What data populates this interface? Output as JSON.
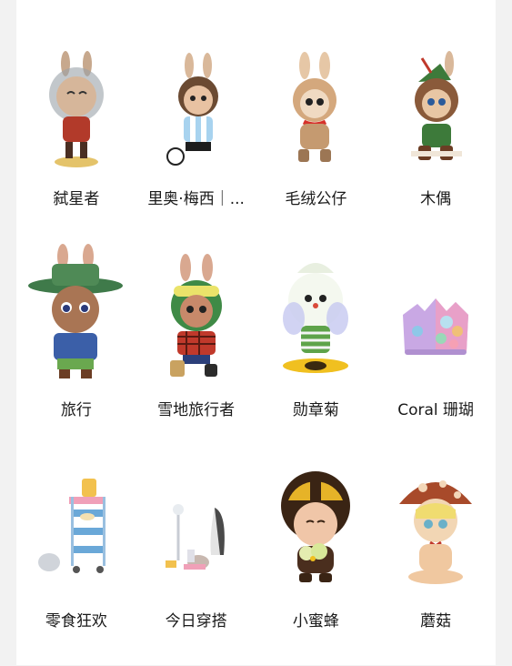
{
  "items": [
    {
      "label": "弑星者",
      "icon": "labubu-space-figure-icon"
    },
    {
      "label": "里奥·梅西｜...",
      "icon": "labubu-soccer-figure-icon"
    },
    {
      "label": "毛绒公仔",
      "icon": "labubu-plush-figure-icon"
    },
    {
      "label": "木偶",
      "icon": "labubu-puppet-figure-icon"
    },
    {
      "label": "旅行",
      "icon": "labubu-hat-figure-icon"
    },
    {
      "label": "雪地旅行者",
      "icon": "labubu-snow-figure-icon"
    },
    {
      "label": "勋章菊",
      "icon": "gazania-figure-icon"
    },
    {
      "label": "Coral 珊瑚",
      "icon": "coral-figure-icon"
    },
    {
      "label": "零食狂欢",
      "icon": "snack-cart-figure-icon"
    },
    {
      "label": "今日穿搭",
      "icon": "outfit-scene-figure-icon"
    },
    {
      "label": "小蜜蜂",
      "icon": "bee-figure-icon"
    },
    {
      "label": "蘑菇",
      "icon": "mushroom-figure-icon"
    }
  ]
}
